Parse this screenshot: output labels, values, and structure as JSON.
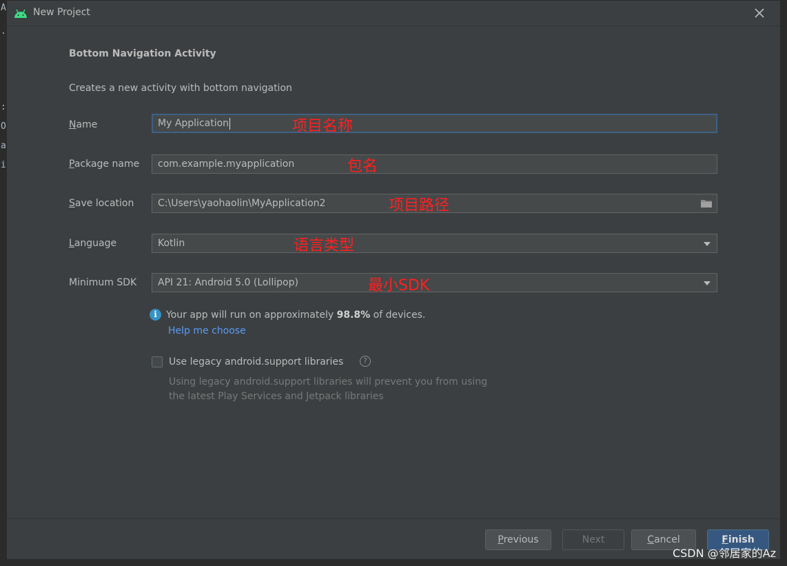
{
  "window": {
    "title": "New Project"
  },
  "ide_background": {
    "glyph_1": "A",
    "glyph_2": ".",
    "glyph_3": ":",
    "glyph_4": "O",
    "glyph_5": "a",
    "glyph_6": "i"
  },
  "header": {
    "title": "Bottom Navigation Activity",
    "description": "Creates a new activity with bottom navigation"
  },
  "form": {
    "name": {
      "label_mnemonic": "N",
      "label_rest": "ame",
      "value": "My Application",
      "annotation": "项目名称"
    },
    "package": {
      "label_mnemonic": "P",
      "label_rest": "ackage name",
      "value": "com.example.myapplication",
      "annotation": "包名"
    },
    "save_location": {
      "label_mnemonic": "S",
      "label_rest": "ave location",
      "value": "C:\\Users\\yaohaolin\\MyApplication2",
      "annotation": "项目路径"
    },
    "language": {
      "label_mnemonic": "L",
      "label_rest": "anguage",
      "value": "Kotlin",
      "annotation": "语言类型"
    },
    "min_sdk": {
      "label": "Minimum SDK",
      "value": "API 21: Android 5.0 (Lollipop)",
      "annotation": "最小SDK"
    }
  },
  "info": {
    "icon_glyph": "i",
    "text_before": "Your app will run on approximately ",
    "percent": "98.8%",
    "text_after": " of devices.",
    "help_link": "Help me choose"
  },
  "legacy": {
    "label": "Use legacy android.support libraries",
    "help_glyph": "?",
    "description_line1": "Using legacy android.support libraries will prevent you from using",
    "description_line2": "the latest Play Services and Jetpack libraries"
  },
  "buttons": {
    "previous_mnemonic": "P",
    "previous_rest": "revious",
    "next": "Next",
    "cancel_mnemonic": "C",
    "cancel_rest": "ancel",
    "finish_mnemonic": "F",
    "finish_rest": "inish"
  },
  "watermark": "CSDN @邻居家的Az",
  "icons": {
    "android": "android-icon",
    "close": "close-icon",
    "folder": "folder-icon",
    "dropdown": "chevron-down-icon",
    "info": "info-icon",
    "help": "help-icon"
  },
  "colors": {
    "dialog_bg": "#3c3f41",
    "field_bg": "#45494a",
    "focus_border": "#3d6185",
    "link": "#589df6",
    "annotation": "#ff2020",
    "primary_button": "#365880",
    "android_green": "#3ddc84"
  }
}
